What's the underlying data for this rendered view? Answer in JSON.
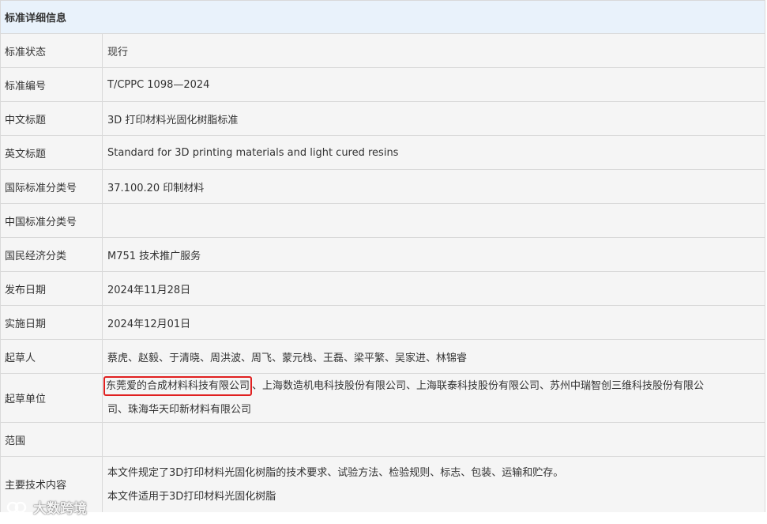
{
  "header": {
    "title": "标准详细信息"
  },
  "rows": [
    {
      "label": "标准状态",
      "value": "现行"
    },
    {
      "label": "标准编号",
      "value": "T/CPPC 1098—2024"
    },
    {
      "label": "中文标题",
      "value": "3D 打印材料光固化树脂标准"
    },
    {
      "label": "英文标题",
      "value": "Standard for 3D printing materials and light cured resins"
    },
    {
      "label": "国际标准分类号",
      "value": "37.100.20 印制材料"
    },
    {
      "label": "中国标准分类号",
      "value": ""
    },
    {
      "label": "国民经济分类",
      "value": "M751 技术推广服务"
    },
    {
      "label": "发布日期",
      "value": "2024年11月28日"
    },
    {
      "label": "实施日期",
      "value": "2024年12月01日"
    },
    {
      "label": "起草人",
      "value": "蔡虎、赵毅、于清晓、周洪波、周飞、蒙元栈、王磊、梁平繁、吴家进、林锦睿"
    },
    {
      "label": "起草单位",
      "highlight": "东莞爱的合成材料科技有限公司",
      "rest": "、上海数造机电科技股份有限公司、上海联泰科技股份有限公司、苏州中瑞智创三维科技股份有限公",
      "line2": "司、珠海华天印新材料有限公司"
    },
    {
      "label": "范围",
      "value": ""
    },
    {
      "label": "主要技术内容",
      "line1": "本文件规定了3D打印材料光固化树脂的技术要求、试验方法、检验规则、标志、包装、运输和贮存。",
      "line2": "本文件适用于3D打印材料光固化树脂"
    }
  ],
  "watermark": {
    "text": "大数跨境",
    "icon": "logo-icon"
  },
  "colors": {
    "header_bg": "#e9f2fb",
    "alt_bg": "#f5f5f5",
    "border": "#d9d9d9",
    "highlight": "#e02020"
  }
}
